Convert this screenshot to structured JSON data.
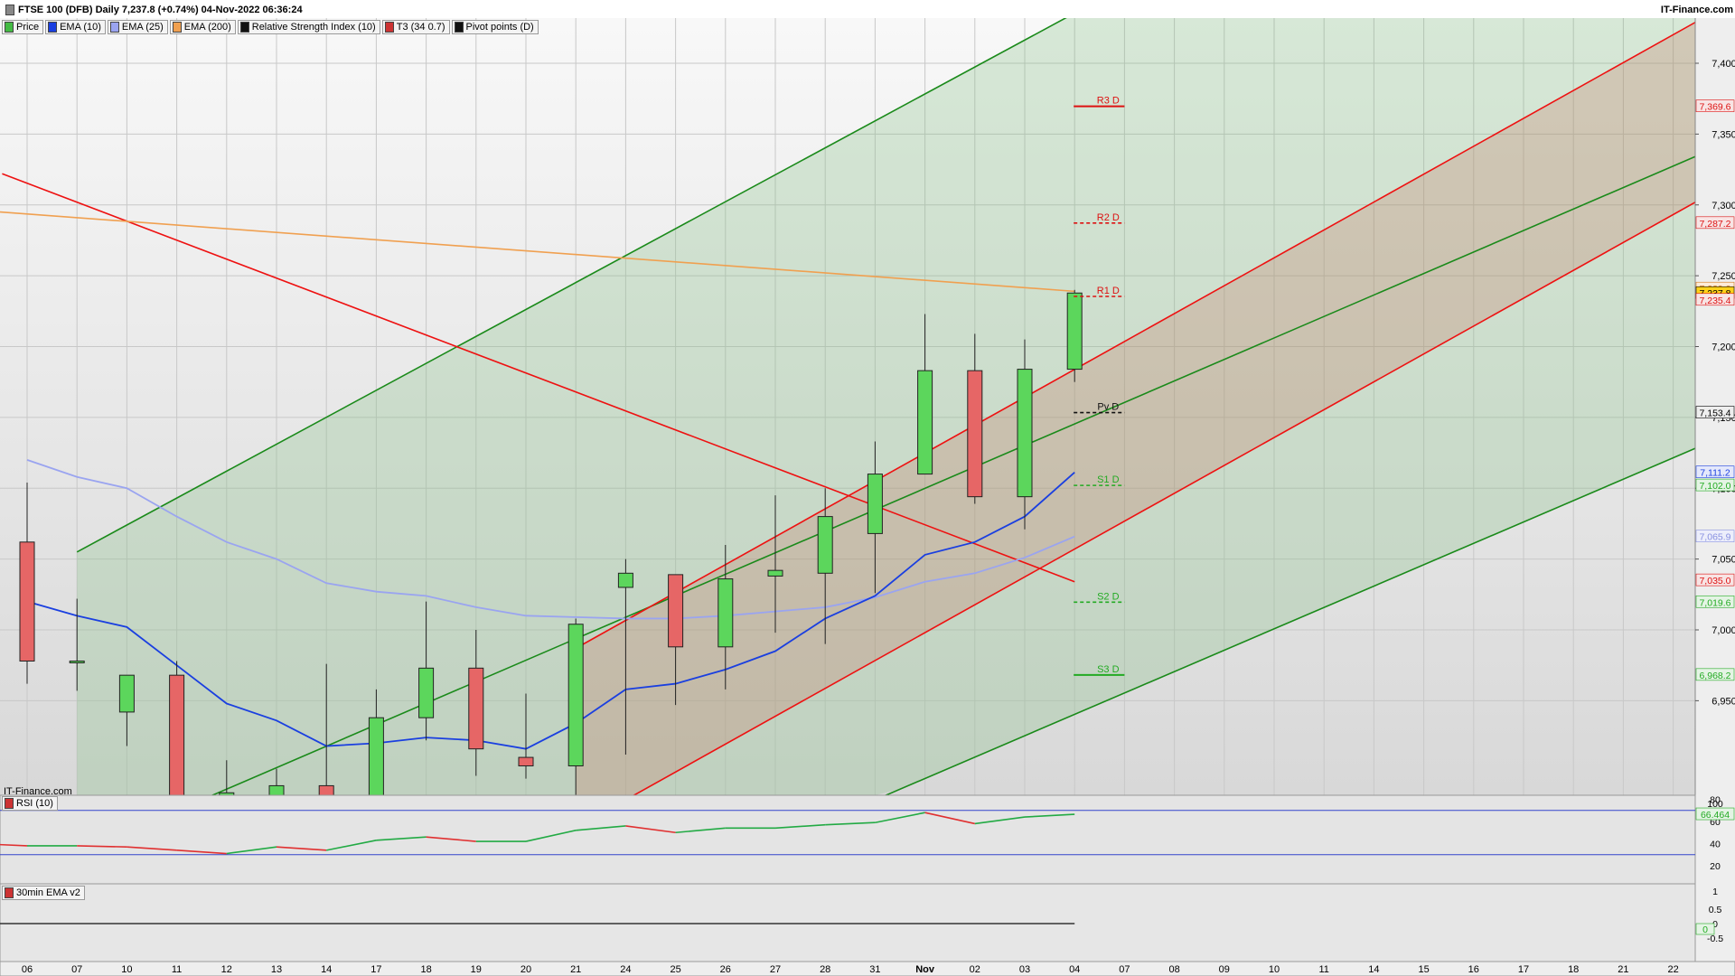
{
  "header": {
    "title": "FTSE 100 (DFB) Daily 7,237.8 (+0.74%) 04-Nov-2022 06:36:24",
    "brand": "IT-Finance.com"
  },
  "legend": [
    {
      "label": "Price",
      "color": "#44bb44"
    },
    {
      "label": "EMA (10)",
      "color": "#1a3fe0"
    },
    {
      "label": "EMA (25)",
      "color": "#9aa4f0"
    },
    {
      "label": "EMA (200)",
      "color": "#f0a050"
    },
    {
      "label": "Relative Strength Index (10)",
      "color": "#111111"
    },
    {
      "label": "T3 (34 0.7)",
      "color": "#cc3333"
    },
    {
      "label": "Pivot points (D)",
      "color": "#111111"
    }
  ],
  "watermark": "IT-Finance.com",
  "rsi_panel": {
    "label": "RSI (10)",
    "ticks": [
      "100",
      "80",
      "60",
      "40",
      "20"
    ],
    "value_label": "66.464",
    "values": [
      40,
      38,
      38,
      37,
      34,
      31,
      37,
      34,
      43,
      46,
      42,
      42,
      52,
      56,
      50,
      54,
      54,
      57,
      59,
      68,
      58,
      64,
      66.5
    ]
  },
  "ema_panel": {
    "label": "30min EMA v2",
    "ticks": [
      "1",
      "0.5",
      "0",
      "-0.5"
    ],
    "value_label": "0"
  },
  "chart_data": {
    "type": "candlestick",
    "x_labels": [
      "06",
      "07",
      "10",
      "11",
      "12",
      "13",
      "14",
      "17",
      "18",
      "19",
      "20",
      "21",
      "24",
      "25",
      "26",
      "27",
      "28",
      "31",
      "Nov",
      "02",
      "03",
      "04",
      "07",
      "08",
      "09",
      "10",
      "11",
      "14",
      "15",
      "16",
      "17",
      "18",
      "21",
      "22"
    ],
    "y_ticks": [
      6950,
      7000,
      7050,
      7100,
      7150,
      7200,
      7250,
      7300,
      7350,
      7400
    ],
    "y_tick_labels": [
      "6,950",
      "7,000",
      "7,050",
      "7,100",
      "7,150",
      "7,200",
      "7,250",
      "7,300",
      "7,350",
      "7,400"
    ],
    "ylim": [
      6880,
      7440
    ],
    "candles": [
      {
        "date": "06",
        "o": 7062,
        "h": 7104,
        "l": 6962,
        "c": 6978
      },
      {
        "date": "07",
        "o": 6978,
        "h": 7022,
        "l": 6957,
        "c": 6978
      },
      {
        "date": "10",
        "o": 6942,
        "h": 6968,
        "l": 6918,
        "c": 6968
      },
      {
        "date": "11",
        "o": 6968,
        "h": 6978,
        "l": 6840,
        "c": 6848
      },
      {
        "date": "12",
        "o": 6850,
        "h": 6908,
        "l": 6825,
        "c": 6885
      },
      {
        "date": "13",
        "o": 6875,
        "h": 6902,
        "l": 6855,
        "c": 6890
      },
      {
        "date": "14",
        "o": 6890,
        "h": 6976,
        "l": 6860,
        "c": 6880
      },
      {
        "date": "17",
        "o": 6882,
        "h": 6958,
        "l": 6870,
        "c": 6938
      },
      {
        "date": "18",
        "o": 6938,
        "h": 7020,
        "l": 6922,
        "c": 6973
      },
      {
        "date": "19",
        "o": 6973,
        "h": 7000,
        "l": 6897,
        "c": 6916
      },
      {
        "date": "20",
        "o": 6910,
        "h": 6955,
        "l": 6895,
        "c": 6904
      },
      {
        "date": "21",
        "o": 6904,
        "h": 7008,
        "l": 6880,
        "c": 7004
      },
      {
        "date": "24",
        "o": 7030,
        "h": 7050,
        "l": 6912,
        "c": 7040
      },
      {
        "date": "25",
        "o": 7039,
        "h": 7039,
        "l": 6947,
        "c": 6988
      },
      {
        "date": "26",
        "o": 6988,
        "h": 7060,
        "l": 6958,
        "c": 7036
      },
      {
        "date": "27",
        "o": 7038,
        "h": 7095,
        "l": 6998,
        "c": 7042
      },
      {
        "date": "28",
        "o": 7040,
        "h": 7100,
        "l": 6990,
        "c": 7080
      },
      {
        "date": "31",
        "o": 7068,
        "h": 7133,
        "l": 7026,
        "c": 7110
      },
      {
        "date": "Nov",
        "o": 7110,
        "h": 7223,
        "l": 7110,
        "c": 7183
      },
      {
        "date": "02",
        "o": 7183,
        "h": 7209,
        "l": 7089,
        "c": 7094
      },
      {
        "date": "03",
        "o": 7094,
        "h": 7205,
        "l": 7071,
        "c": 7184
      },
      {
        "date": "04",
        "o": 7184,
        "h": 7240,
        "l": 7175,
        "c": 7237.8
      }
    ],
    "ema10": [
      7020,
      7010,
      7002,
      6975,
      6948,
      6936,
      6918,
      6920,
      6924,
      6922,
      6916,
      6934,
      6958,
      6962,
      6972,
      6985,
      7008,
      7024,
      7053,
      7062,
      7080,
      7111.2
    ],
    "ema25": [
      7120,
      7108,
      7100,
      7080,
      7062,
      7050,
      7033,
      7027,
      7024,
      7016,
      7010,
      7009,
      7008,
      7008,
      7010,
      7013,
      7016,
      7023,
      7034,
      7040,
      7051,
      7065.9
    ],
    "ema200": {
      "start": 7295,
      "end": 7239
    },
    "pivots": [
      {
        "label": "R3 D",
        "value": 7369.6,
        "color": "#dd1111",
        "dashed": false
      },
      {
        "label": "R2 D",
        "value": 7287.2,
        "color": "#dd1111",
        "dashed": true
      },
      {
        "label": "R1 D",
        "value": 7235.4,
        "color": "#dd1111",
        "dashed": true
      },
      {
        "label": "Pv D",
        "value": 7153.4,
        "color": "#111111",
        "dashed": true
      },
      {
        "label": "S1 D",
        "value": 7102.0,
        "color": "#22aa22",
        "dashed": true
      },
      {
        "label": "S2 D",
        "value": 7019.6,
        "color": "#22aa22",
        "dashed": true
      },
      {
        "label": "S3 D",
        "value": 6968.2,
        "color": "#22aa22",
        "dashed": false
      }
    ],
    "price_labels": [
      {
        "text": "7,369.6",
        "value": 7369.6,
        "bg": "#f8e4e4",
        "fg": "#dd1111"
      },
      {
        "text": "7,287.2",
        "value": 7287.2,
        "bg": "#f8e4e4",
        "fg": "#dd1111"
      },
      {
        "text": "7,239.0",
        "value": 7241,
        "bg": "#fdebd8",
        "fg": "#d07820"
      },
      {
        "text": "7,237.8",
        "value": 7237.8,
        "bg": "#ffd21a",
        "fg": "#000000"
      },
      {
        "text": "7,235.4",
        "value": 7233,
        "bg": "#f8e4e4",
        "fg": "#dd1111"
      },
      {
        "text": "7,153.4",
        "value": 7153.4,
        "bg": "#eeeeee",
        "fg": "#000000"
      },
      {
        "text": "7,111.2",
        "value": 7111.2,
        "bg": "#e4e8fb",
        "fg": "#1a3fe0"
      },
      {
        "text": "7,102.0",
        "value": 7102.0,
        "bg": "#e4f4e4",
        "fg": "#22aa22"
      },
      {
        "text": "7,065.9",
        "value": 7065.9,
        "bg": "#eceefb",
        "fg": "#8890e0"
      },
      {
        "text": "7,035.0",
        "value": 7035.0,
        "bg": "#f8e4e4",
        "fg": "#dd1111"
      },
      {
        "text": "7,019.6",
        "value": 7019.6,
        "bg": "#e4f4e4",
        "fg": "#22aa22"
      },
      {
        "text": "6,968.2",
        "value": 6968.2,
        "bg": "#e4f4e4",
        "fg": "#22aa22"
      }
    ],
    "trendlines": [
      {
        "name": "green-channel-upper",
        "color": "#1a8a1a",
        "x1": 1,
        "y1": 7055,
        "x2": 26.5,
        "y2": 7540,
        "clip": true
      },
      {
        "name": "green-channel-mid",
        "color": "#1a8a1a",
        "x1": 3.5,
        "y1": 6880,
        "x2": 33.5,
        "y2": 7335,
        "clip": true
      },
      {
        "name": "green-channel-lower",
        "color": "#1a8a1a",
        "x1": 17,
        "y1": 6880,
        "x2": 33.5,
        "y2": 7129,
        "clip": true
      },
      {
        "name": "red-channel-upper",
        "color": "#ee1111",
        "x1": 11,
        "y1": 6987,
        "x2": 33.5,
        "y2": 7430,
        "clip": true
      },
      {
        "name": "red-channel-lower",
        "color": "#ee1111",
        "x1": 12,
        "y1": 6880,
        "x2": 33.5,
        "y2": 7303,
        "clip": true
      },
      {
        "name": "red-downtrend",
        "color": "#ee1111",
        "x1": -0.5,
        "y1": 7322,
        "x2": 21,
        "y2": 7034,
        "clip": true
      }
    ]
  }
}
